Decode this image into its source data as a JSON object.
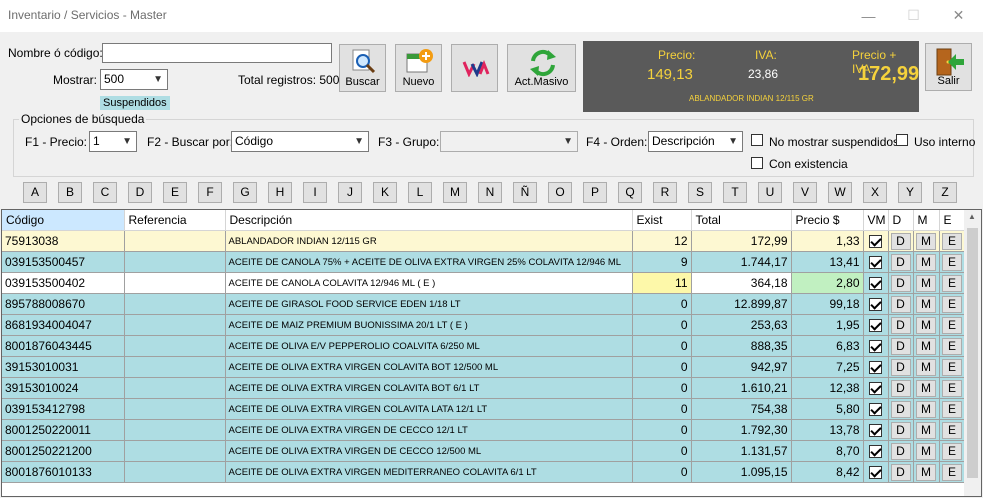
{
  "window": {
    "title": "Inventario / Servicios - Master"
  },
  "search": {
    "name_label": "Nombre ó código:",
    "name_value": "",
    "show_label": "Mostrar:",
    "show_value": "500",
    "total_label": "Total registros: 500",
    "suspended_badge": "Suspendidos"
  },
  "toolbar": {
    "buscar": "Buscar",
    "nuevo": "Nuevo",
    "act_masivo": "Act.Masivo",
    "salir": "Salir"
  },
  "price_panel": {
    "precio_label": "Precio:",
    "precio_value": "149,13",
    "iva_label": "IVA:",
    "iva_value": "23,86",
    "total_label": "Precio + IVA:",
    "total_value": "172,99",
    "product": "ABLANDADOR INDIAN 12/115 GR"
  },
  "options": {
    "legend": "Opciones de búsqueda",
    "f1_label": "F1 - Precio:",
    "f1_value": "1",
    "f2_label": "F2 - Buscar por:",
    "f2_value": "Código",
    "f3_label": "F3 - Grupo:",
    "f3_value": "",
    "f4_label": "F4 - Orden:",
    "f4_value": "Descripción",
    "no_suspendidos": "No mostrar suspendidos",
    "uso_interno": "Uso interno",
    "con_existencia": "Con existencia"
  },
  "letters": [
    "A",
    "B",
    "C",
    "D",
    "E",
    "F",
    "G",
    "H",
    "I",
    "J",
    "K",
    "L",
    "M",
    "N",
    "Ñ",
    "O",
    "P",
    "Q",
    "R",
    "S",
    "T",
    "U",
    "V",
    "W",
    "X",
    "Y",
    "Z"
  ],
  "grid": {
    "columns": [
      "Código",
      "Referencia",
      "Descripción",
      "Exist",
      "Total",
      "Precio $",
      "VM",
      "D",
      "M",
      "E"
    ],
    "row_button_labels": {
      "d": "D",
      "m": "M",
      "e": "E"
    },
    "rows": [
      {
        "codigo": "75913038",
        "referencia": "",
        "descripcion": "ABLANDADOR INDIAN 12/115 GR",
        "exist": "12",
        "total": "172,99",
        "precio": "1,33",
        "vm": true
      },
      {
        "codigo": "039153500457",
        "referencia": "",
        "descripcion": "ACEITE DE CANOLA 75% + ACEITE DE OLIVA EXTRA VIRGEN 25% COLAVITA 12/946 ML",
        "exist": "9",
        "total": "1.744,17",
        "precio": "13,41",
        "vm": true
      },
      {
        "codigo": "039153500402",
        "referencia": "",
        "descripcion": "ACEITE DE CANOLA COLAVITA 12/946 ML ( E )",
        "exist": "11",
        "total": "364,18",
        "precio": "2,80",
        "vm": true
      },
      {
        "codigo": "895788008670",
        "referencia": "",
        "descripcion": "ACEITE DE GIRASOL FOOD SERVICE EDEN 1/18 LT",
        "exist": "0",
        "total": "12.899,87",
        "precio": "99,18",
        "vm": true
      },
      {
        "codigo": "8681934004047",
        "referencia": "",
        "descripcion": "ACEITE DE MAIZ PREMIUM BUONISSIMA 20/1 LT ( E )",
        "exist": "0",
        "total": "253,63",
        "precio": "1,95",
        "vm": true
      },
      {
        "codigo": "8001876043445",
        "referencia": "",
        "descripcion": "ACEITE DE OLIVA E/V PEPPEROLIO COALVITA 6/250 ML",
        "exist": "0",
        "total": "888,35",
        "precio": "6,83",
        "vm": true
      },
      {
        "codigo": "39153010031",
        "referencia": "",
        "descripcion": "ACEITE DE OLIVA EXTRA VIRGEN COLAVITA BOT 12/500 ML",
        "exist": "0",
        "total": "942,97",
        "precio": "7,25",
        "vm": true
      },
      {
        "codigo": "39153010024",
        "referencia": "",
        "descripcion": "ACEITE DE OLIVA EXTRA VIRGEN COLAVITA BOT 6/1 LT",
        "exist": "0",
        "total": "1.610,21",
        "precio": "12,38",
        "vm": true
      },
      {
        "codigo": "039153412798",
        "referencia": "",
        "descripcion": "ACEITE DE OLIVA EXTRA VIRGEN COLAVITA LATA 12/1 LT",
        "exist": "0",
        "total": "754,38",
        "precio": "5,80",
        "vm": true
      },
      {
        "codigo": "8001250220011",
        "referencia": "",
        "descripcion": "ACEITE DE OLIVA EXTRA VIRGEN DE CECCO 12/1 LT",
        "exist": "0",
        "total": "1.792,30",
        "precio": "13,78",
        "vm": true
      },
      {
        "codigo": "8001250221200",
        "referencia": "",
        "descripcion": "ACEITE DE OLIVA EXTRA VIRGEN DE CECCO 12/500 ML",
        "exist": "0",
        "total": "1.131,57",
        "precio": "8,70",
        "vm": true
      },
      {
        "codigo": "8001876010133",
        "referencia": "",
        "descripcion": "ACEITE DE OLIVA EXTRA VIRGEN MEDITERRANEO COLAVITA 6/1 LT",
        "exist": "0",
        "total": "1.095,15",
        "precio": "8,42",
        "vm": true
      }
    ]
  },
  "colors": {
    "row_selected": "#fdf8d2",
    "row_default": "#aedde3",
    "row_white": "#ffffff",
    "exist_highlight": "#fdf8a9",
    "price_highlight": "#c1f0c1",
    "header_selected": "#cce8ff",
    "panel_bg": "#5a5a5a",
    "panel_gold": "#f5d23c"
  },
  "row_styles": [
    "selected",
    "default",
    "highlight",
    "default",
    "default",
    "default",
    "default",
    "default",
    "default",
    "default",
    "default",
    "default"
  ]
}
